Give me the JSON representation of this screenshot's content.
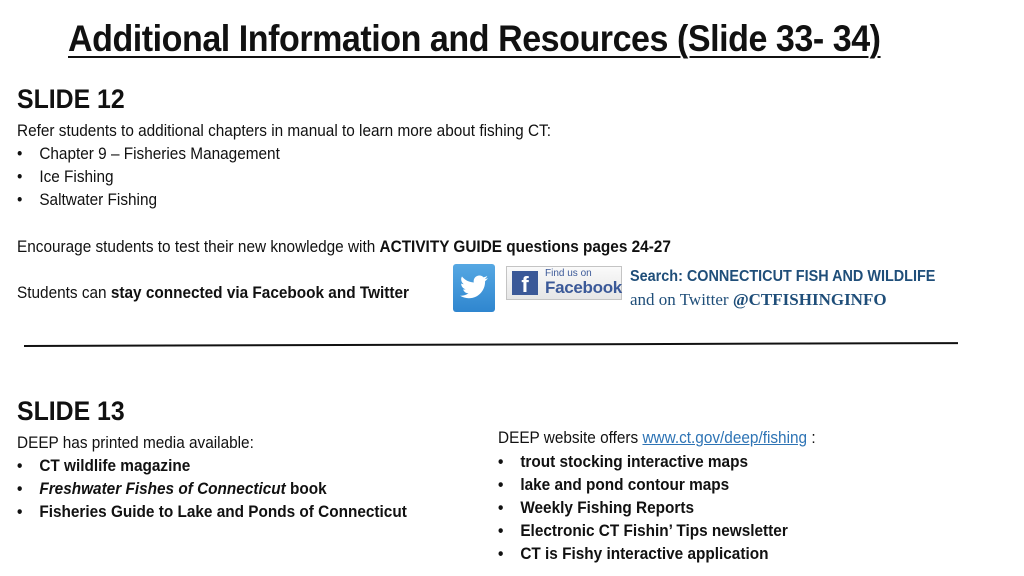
{
  "title": "Additional Information and Resources (Slide 33- 34)",
  "slide12": {
    "heading": "SLIDE 12",
    "intro": "Refer students to additional chapters in manual to learn more about fishing CT:",
    "chapters": [
      "Chapter 9 – Fisheries Management",
      "Ice Fishing",
      "Saltwater Fishing"
    ],
    "encourage_prefix": "Encourage students to test their new knowledge with ",
    "encourage_bold": "ACTIVITY GUIDE questions pages 24-27",
    "connect_prefix": "Students can ",
    "connect_bold": "stay connected via Facebook and Twitter",
    "twitter_icon": "twitter-bird-icon",
    "facebook_badge": {
      "small": "Find us on",
      "big": "Facebook",
      "logo": "f"
    },
    "search_text": "Search: CONNECTICUT FISH AND WILDLIFE",
    "twitter_prefix": "and on Twitter ",
    "twitter_handle": "@CTFISHINGINFO"
  },
  "slide13": {
    "heading": "SLIDE 13",
    "printed_intro": "DEEP has printed media available:",
    "printed_items": [
      {
        "italic": "",
        "bold": "CT wildlife magazine"
      },
      {
        "italic": "Freshwater Fishes of Connecticut",
        "bold": " book"
      },
      {
        "italic": "",
        "bold": "Fisheries Guide to Lake and Ponds of Connecticut"
      }
    ],
    "website_prefix": "DEEP website offers ",
    "website_link": "www.ct.gov/deep/fishing",
    "website_suffix": " :",
    "website_items": [
      "trout stocking interactive maps",
      "lake and pond contour maps",
      "Weekly Fishing Reports",
      "Electronic CT Fishin’ Tips newsletter",
      "CT is Fishy interactive application"
    ]
  }
}
